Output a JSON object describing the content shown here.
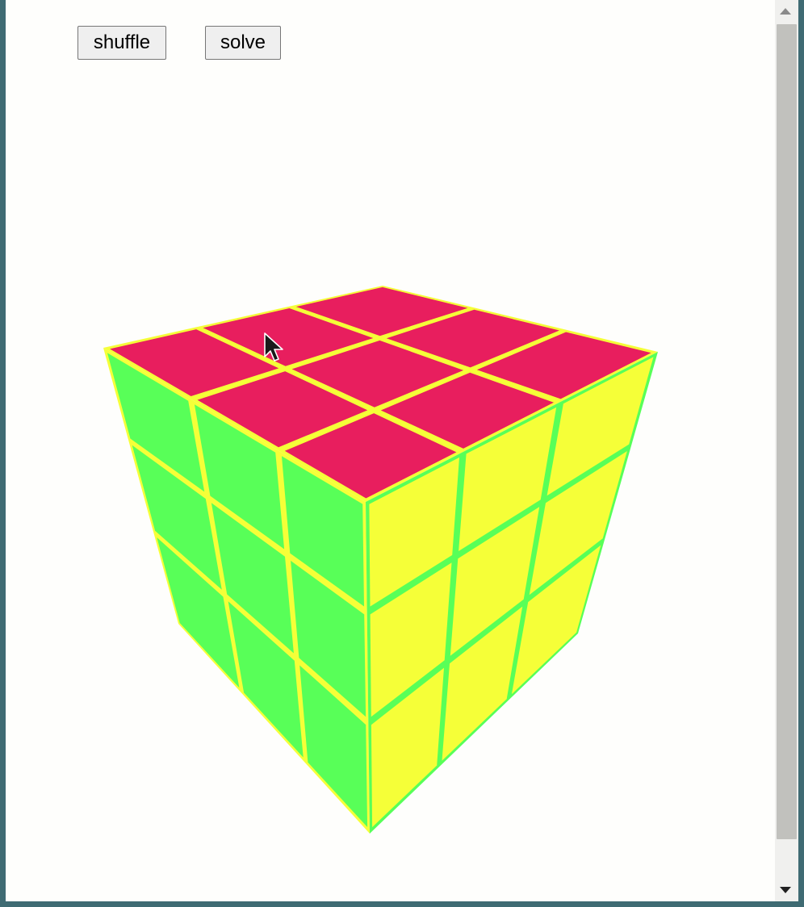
{
  "toolbar": {
    "shuffle_label": "shuffle",
    "solve_label": "solve"
  },
  "cube": {
    "size": 3,
    "colors": {
      "top": "#e81e5e",
      "left": "#58ff58",
      "right": "#f5ff38"
    },
    "faces": {
      "top": [
        [
          "top",
          "top",
          "top"
        ],
        [
          "top",
          "top",
          "top"
        ],
        [
          "top",
          "top",
          "top"
        ]
      ],
      "left": [
        [
          "left",
          "left",
          "left"
        ],
        [
          "left",
          "left",
          "left"
        ],
        [
          "left",
          "left",
          "left"
        ]
      ],
      "right": [
        [
          "right",
          "right",
          "right"
        ],
        [
          "right",
          "right",
          "right"
        ],
        [
          "right",
          "right",
          "right"
        ]
      ]
    }
  },
  "cursor": {
    "icon": "arrow-cursor-icon"
  }
}
